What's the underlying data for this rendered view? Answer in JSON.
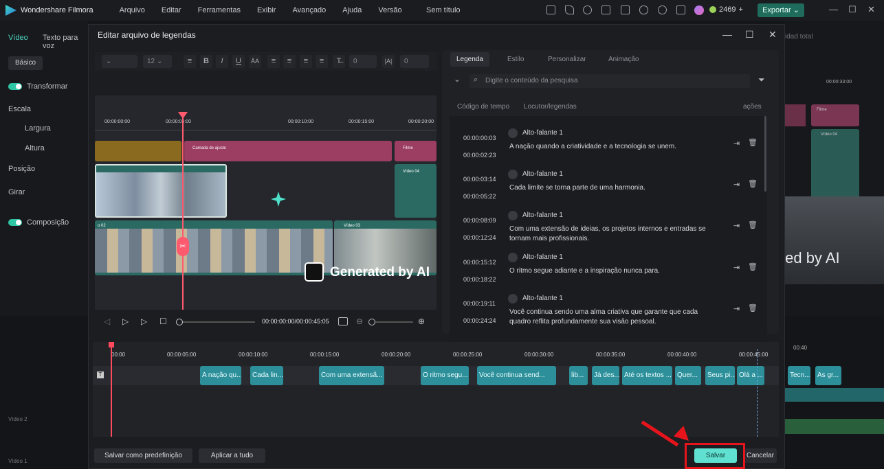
{
  "app": {
    "name": "Wondershare Filmora",
    "doc_title": "Sem título",
    "credits": "2469",
    "export_label": "Exportar"
  },
  "menu": [
    "Arquivo",
    "Editar",
    "Ferramentas",
    "Exibir",
    "Avançado",
    "Ajuda",
    "Versão"
  ],
  "leftpanel": {
    "tab1": "Vídeo",
    "tab2": "Texto para voz",
    "basic": "Básico",
    "transform": "Transformar",
    "scale": "Escala",
    "width": "Largura",
    "height": "Altura",
    "position": "Posição",
    "rotate": "Girar",
    "composition": "Composição",
    "video2": "Vídeo 2",
    "video1": "Vídeo 1"
  },
  "rightbg": {
    "quality": "idad total",
    "time": "00:00:33:00",
    "clip1": "Vídeo 04",
    "clip2": "Filme",
    "overlay": "ted by AI",
    "tl_label": "00:40"
  },
  "dialog": {
    "title": "Editar arquivo de legendas",
    "font_size": "12",
    "spacing1": "0",
    "spacing2": "0",
    "preview": {
      "ruler": [
        "00:00:00:00",
        "00:00:05:00",
        "00:00:10:00",
        "00:00:15:00",
        "00:00:20:00"
      ],
      "adjust_layer": "Camada de ajuste",
      "filme": "Filme",
      "video04": "Vídeo 04",
      "video02": "o 02",
      "video03": "Vídeo 03",
      "watermark": "Generated by AI"
    },
    "time_display": "00:00:00:00/00:00:45:05",
    "tabs": [
      "Legenda",
      "Estilo",
      "Personalizar",
      "Animação"
    ],
    "search_placeholder": "Digite o conteúdo da pesquisa",
    "columns": {
      "time": "Código de tempo",
      "speaker": "Locutor/legendas",
      "actions": "ações"
    },
    "entries": [
      {
        "start": "00:00:00:03",
        "end": "00:00:02:23",
        "speaker": "Alto-falante 1",
        "text": "A nação quando a criatividade e a tecnologia se unem."
      },
      {
        "start": "00:00:03:14",
        "end": "00:00:05:22",
        "speaker": "Alto-falante 1",
        "text": "Cada limite se torna parte de uma harmonia."
      },
      {
        "start": "00:00:08:09",
        "end": "00:00:12:24",
        "speaker": "Alto-falante 1",
        "text": "Com uma extensão de ideias, os projetos internos e entradas se tornam mais profissionais."
      },
      {
        "start": "00:00:15:12",
        "end": "00:00:18:22",
        "speaker": "Alto-falante 1",
        "text": "O ritmo segue adiante e a inspiração nunca para."
      },
      {
        "start": "00:00:19:11",
        "end": "00:00:24:24",
        "speaker": "Alto-falante 1",
        "text": "Você continua sendo uma alma criativa que garante que cada quadro reflita profundamente sua visão pessoal."
      }
    ],
    "timeline": {
      "ruler": [
        "00:00",
        "00:00:05:00",
        "00:00:10:00",
        "00:00:15:00",
        "00:00:20:00",
        "00:00:25:00",
        "00:00:30:00",
        "00:00:35:00",
        "00:00:40:00",
        "00:00:45:00"
      ],
      "chips": [
        "A nação qu...",
        "Cada lin...",
        "Com uma extensã...",
        "O ritmo segu...",
        "Você continua send...",
        "lib...",
        "Já des...",
        "Até os textos ...",
        "Quer...",
        "Seus pi...",
        "Olá a ...",
        "Tecn...",
        "As gr..."
      ]
    },
    "buttons": {
      "save_preset": "Salvar como predefinição",
      "apply_all": "Aplicar a tudo",
      "save": "Salvar",
      "cancel": "Cancelar"
    }
  },
  "colors": {
    "accent": "#5fe0d0",
    "highlight": "#e8141c",
    "chip": "#2c8f99"
  }
}
